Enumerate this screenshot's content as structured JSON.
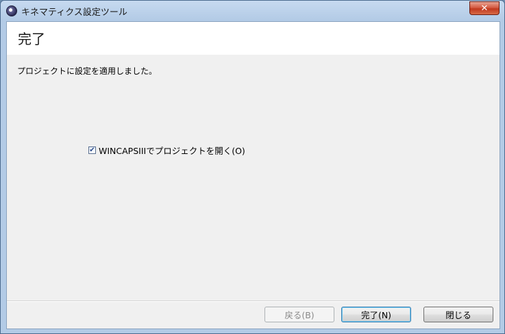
{
  "window": {
    "title": "キネマティクス設定ツール",
    "close_label": "✕",
    "app_icon": "app-icon"
  },
  "page": {
    "title": "完了",
    "message": "プロジェクトに設定を適用しました。"
  },
  "option": {
    "label": "WINCAPSIIIでプロジェクトを開く(O)",
    "checked": true,
    "check_glyph": "✔"
  },
  "buttons": {
    "back": "戻る(B)",
    "finish": "完了(N)",
    "close": "閉じる"
  }
}
